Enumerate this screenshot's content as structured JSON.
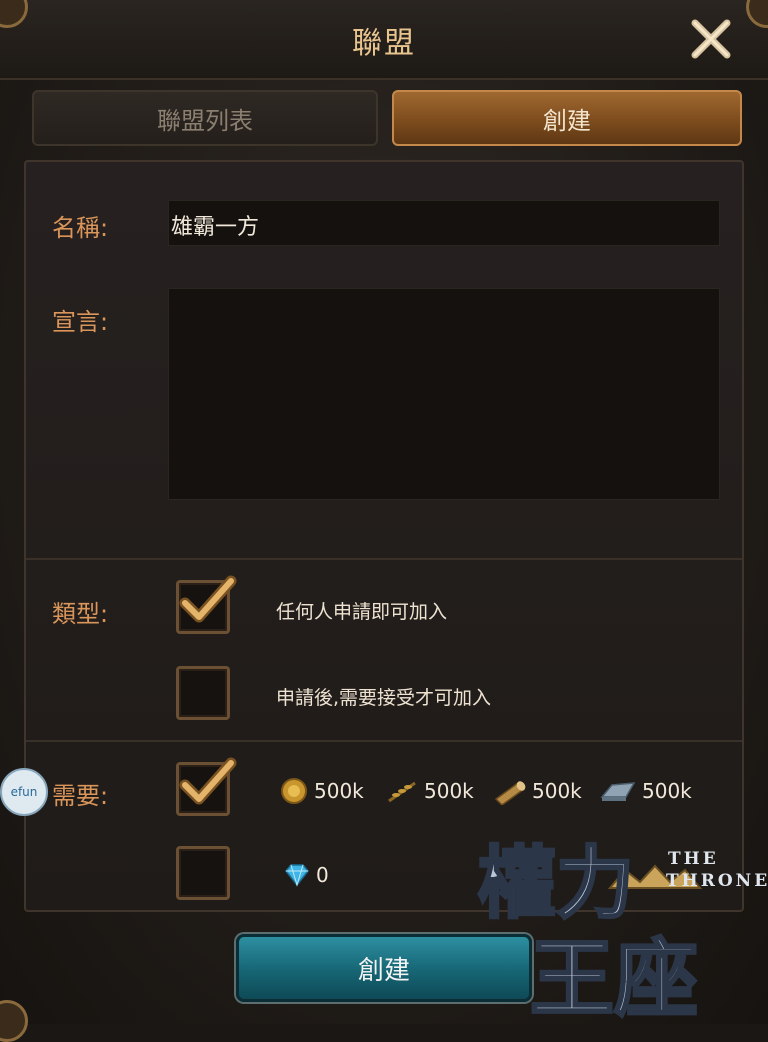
{
  "window": {
    "title": "聯盟",
    "close_icon": "close-icon"
  },
  "tabs": [
    {
      "label": "聯盟列表",
      "active": false
    },
    {
      "label": "創建",
      "active": true
    }
  ],
  "form": {
    "name_label": "名稱:",
    "name_value": "雄霸一方",
    "declaration_label": "宣言:",
    "declaration_value": "",
    "type_label": "類型:",
    "type_options": [
      {
        "text": "任何人申請即可加入",
        "checked": true
      },
      {
        "text": "申請後,需要接受才可加入",
        "checked": false
      }
    ],
    "requirement_label": "需要:",
    "requirement_options": [
      {
        "checked": true,
        "resources": [
          {
            "icon": "gold-coin-icon",
            "amount": "500k"
          },
          {
            "icon": "wheat-icon",
            "amount": "500k"
          },
          {
            "icon": "wood-log-icon",
            "amount": "500k"
          },
          {
            "icon": "iron-ingot-icon",
            "amount": "500k"
          }
        ]
      },
      {
        "checked": false,
        "resources": [
          {
            "icon": "diamond-icon",
            "amount": "0"
          }
        ]
      }
    ]
  },
  "create_button": "創建",
  "efun_badge": "efun",
  "logo": {
    "chinese": "權力王座",
    "english_line1": "THE",
    "english_line2": "THRONE"
  },
  "colors": {
    "accent_orange": "#d9955a",
    "tab_active": "#7a4a1c",
    "button_teal": "#166574"
  }
}
